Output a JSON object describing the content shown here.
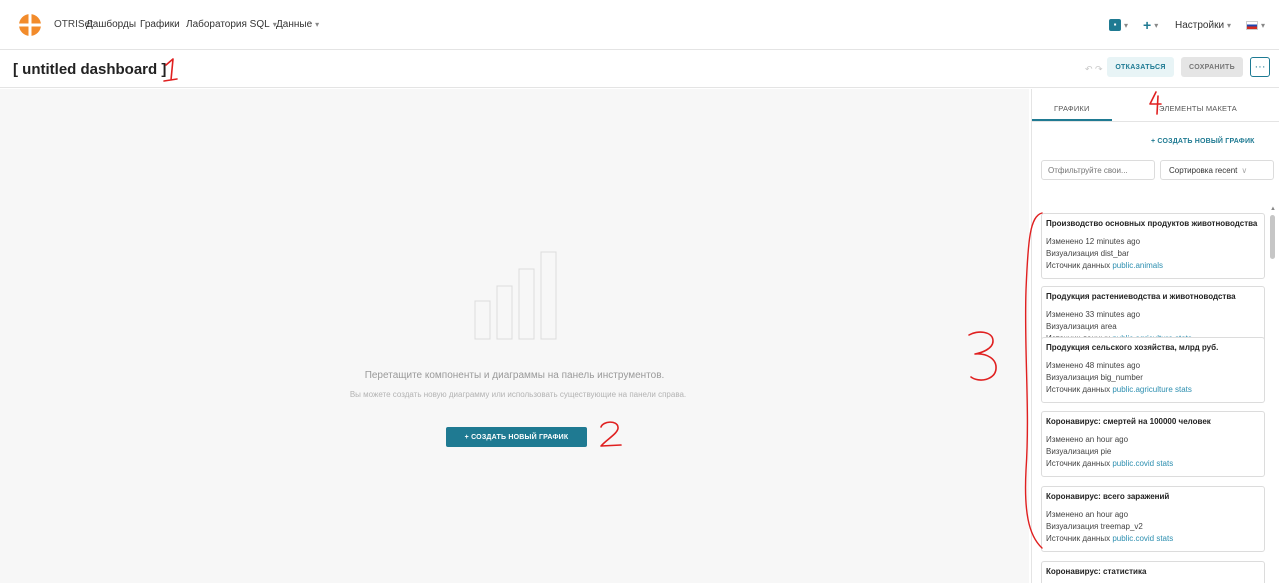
{
  "navbar": {
    "brand": "OTRISet",
    "items": [
      {
        "label": "Дашборды",
        "dropdown": false
      },
      {
        "label": "Графики",
        "dropdown": false
      },
      {
        "label": "Лаборатория SQL",
        "dropdown": true
      },
      {
        "label": "Данные",
        "dropdown": true
      }
    ],
    "settings_label": "Настройки",
    "caret": "▾"
  },
  "header": {
    "title": "[ untitled dashboard ]",
    "discard_label": "ОТКАЗАТЬСЯ",
    "save_label": "СОХРАНИТЬ",
    "more_label": "···"
  },
  "canvas": {
    "drop_title": "Перетащите компоненты и диаграммы на панель инструментов.",
    "drop_subtitle": "Вы можете создать новую диаграмму или использовать существующие на панели справа.",
    "create_button": "+ СОЗДАТЬ НОВЫЙ ГРАФИК"
  },
  "panel": {
    "tabs": [
      {
        "label": "ГРАФИКИ",
        "active": true
      },
      {
        "label": "ЭЛЕМЕНТЫ МАКЕТА",
        "active": false
      }
    ],
    "create_link": "+ СОЗДАТЬ НОВЫЙ ГРАФИК",
    "filter_placeholder": "Отфильтруйте свои...",
    "sort_label": "Сортировка recent",
    "field_labels": {
      "modified": "Изменено",
      "viz": "Визуализация",
      "source": "Источник данных"
    },
    "charts": [
      {
        "title": "Производство основных продуктов животноводства",
        "modified": "12 minutes ago",
        "viz": "dist_bar",
        "source": "public.animals"
      },
      {
        "title": "Продукция растениеводства и животноводства",
        "modified": "33 minutes ago",
        "viz": "area",
        "source": "public.agriculture stats"
      },
      {
        "title": "Продукция сельского хозяйства, млрд руб.",
        "modified": "48 minutes ago",
        "viz": "big_number",
        "source": "public.agriculture stats"
      },
      {
        "title": "Коронавирус: смертей на 100000 человек",
        "modified": "an hour ago",
        "viz": "pie",
        "source": "public.covid stats"
      },
      {
        "title": "Коронавирус: всего заражений",
        "modified": "an hour ago",
        "viz": "treemap_v2",
        "source": "public.covid stats"
      },
      {
        "title": "Коронавирус: статистика"
      }
    ]
  },
  "annotations": {
    "n1": "1",
    "n2": "2",
    "n3": "3",
    "n4": "4",
    "color": "#e02020"
  },
  "colors": {
    "accent": "#1f7a92",
    "link": "#2d8fb0",
    "annotation": "#e02020"
  }
}
